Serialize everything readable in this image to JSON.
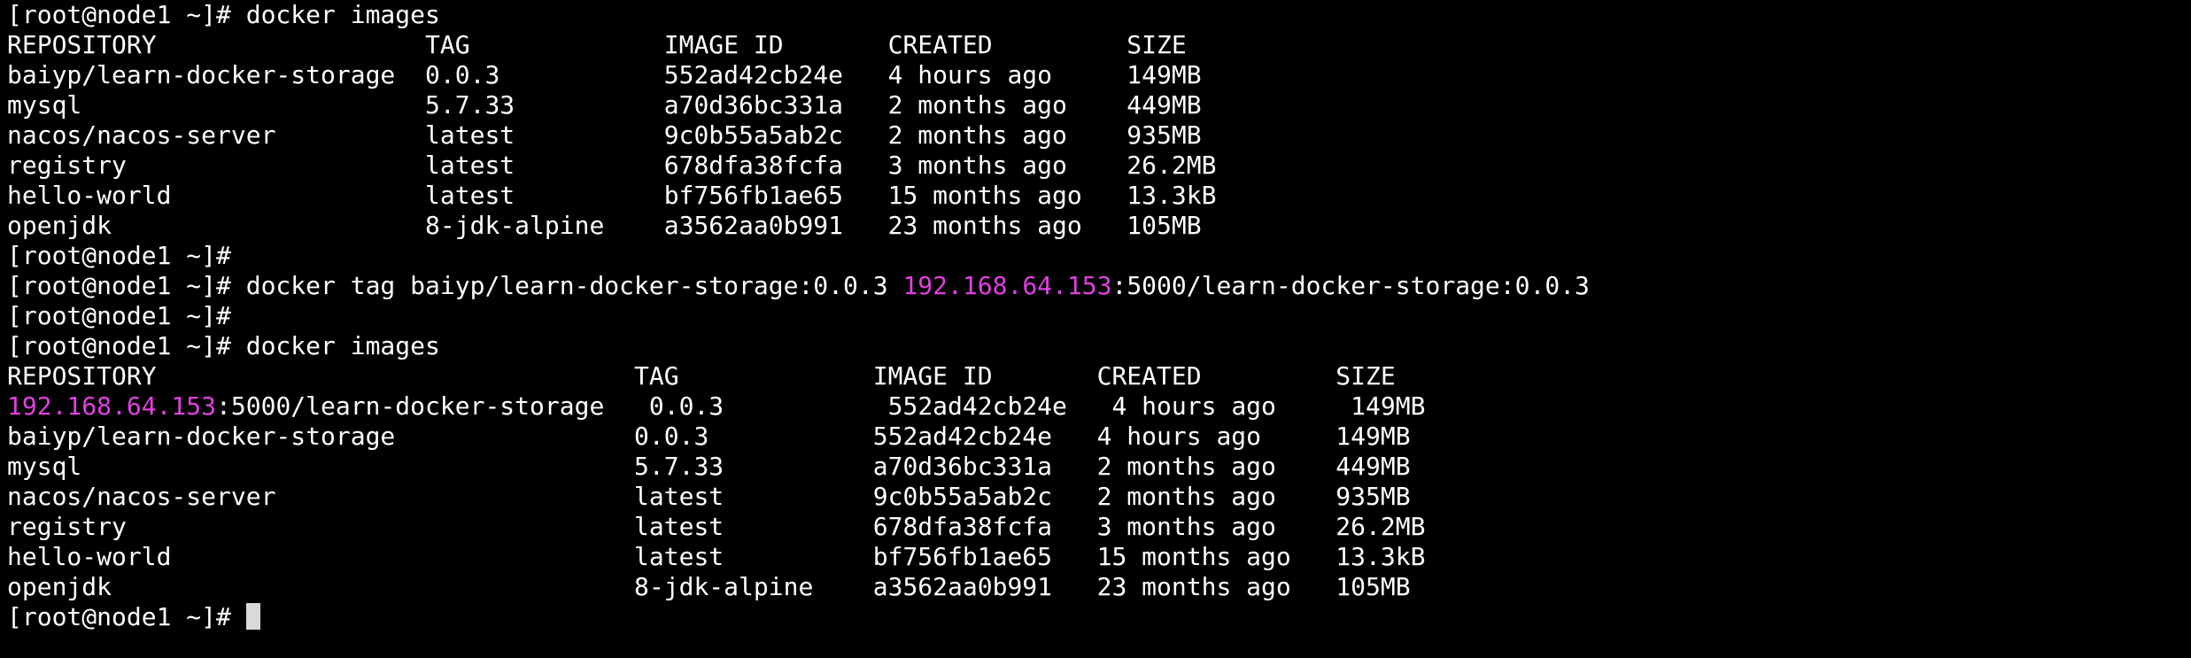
{
  "colors": {
    "background": "#000000",
    "text": "#ffffff",
    "ip_highlight": "#e040e0",
    "cursor": "#d9d9d9"
  },
  "prompt": "[root@node1 ~]# ",
  "lines": [
    {
      "kind": "cmd",
      "parts": [
        {
          "t": "docker images"
        }
      ]
    },
    {
      "kind": "out",
      "parts": [
        {
          "t": "REPOSITORY                  TAG             IMAGE ID       CREATED         SIZE"
        }
      ]
    },
    {
      "kind": "out",
      "parts": [
        {
          "t": "baiyp/learn-docker-storage  0.0.3           552ad42cb24e   4 hours ago     149MB"
        }
      ]
    },
    {
      "kind": "out",
      "parts": [
        {
          "t": "mysql                       5.7.33          a70d36bc331a   2 months ago    449MB"
        }
      ]
    },
    {
      "kind": "out",
      "parts": [
        {
          "t": "nacos/nacos-server          latest          9c0b55a5ab2c   2 months ago    935MB"
        }
      ]
    },
    {
      "kind": "out",
      "parts": [
        {
          "t": "registry                    latest          678dfa38fcfa   3 months ago    26.2MB"
        }
      ]
    },
    {
      "kind": "out",
      "parts": [
        {
          "t": "hello-world                 latest          bf756fb1ae65   15 months ago   13.3kB"
        }
      ]
    },
    {
      "kind": "out",
      "parts": [
        {
          "t": "openjdk                     8-jdk-alpine    a3562aa0b991   23 months ago   105MB"
        }
      ]
    },
    {
      "kind": "cmd",
      "parts": []
    },
    {
      "kind": "cmd",
      "parts": [
        {
          "t": "docker tag baiyp/learn-docker-storage:0.0.3 "
        },
        {
          "t": "192.168.64.153",
          "ip": true
        },
        {
          "t": ":5000/learn-docker-storage:0.0.3"
        }
      ]
    },
    {
      "kind": "cmd",
      "parts": []
    },
    {
      "kind": "cmd",
      "parts": [
        {
          "t": "docker images"
        }
      ]
    },
    {
      "kind": "out",
      "parts": [
        {
          "t": "REPOSITORY                                TAG             IMAGE ID       CREATED         SIZE"
        }
      ]
    },
    {
      "kind": "out",
      "parts": [
        {
          "t": "192.168.64.153",
          "ip": true
        },
        {
          "t": ":5000/learn-docker-storage   0.0.3           552ad42cb24e   4 hours ago     149MB"
        }
      ]
    },
    {
      "kind": "out",
      "parts": [
        {
          "t": "baiyp/learn-docker-storage                0.0.3           552ad42cb24e   4 hours ago     149MB"
        }
      ]
    },
    {
      "kind": "out",
      "parts": [
        {
          "t": "mysql                                     5.7.33          a70d36bc331a   2 months ago    449MB"
        }
      ]
    },
    {
      "kind": "out",
      "parts": [
        {
          "t": "nacos/nacos-server                        latest          9c0b55a5ab2c   2 months ago    935MB"
        }
      ]
    },
    {
      "kind": "out",
      "parts": [
        {
          "t": "registry                                  latest          678dfa38fcfa   3 months ago    26.2MB"
        }
      ]
    },
    {
      "kind": "out",
      "parts": [
        {
          "t": "hello-world                               latest          bf756fb1ae65   15 months ago   13.3kB"
        }
      ]
    },
    {
      "kind": "out",
      "parts": [
        {
          "t": "openjdk                                   8-jdk-alpine    a3562aa0b991   23 months ago   105MB"
        }
      ]
    },
    {
      "kind": "cmd",
      "parts": [],
      "cursor": true
    }
  ]
}
